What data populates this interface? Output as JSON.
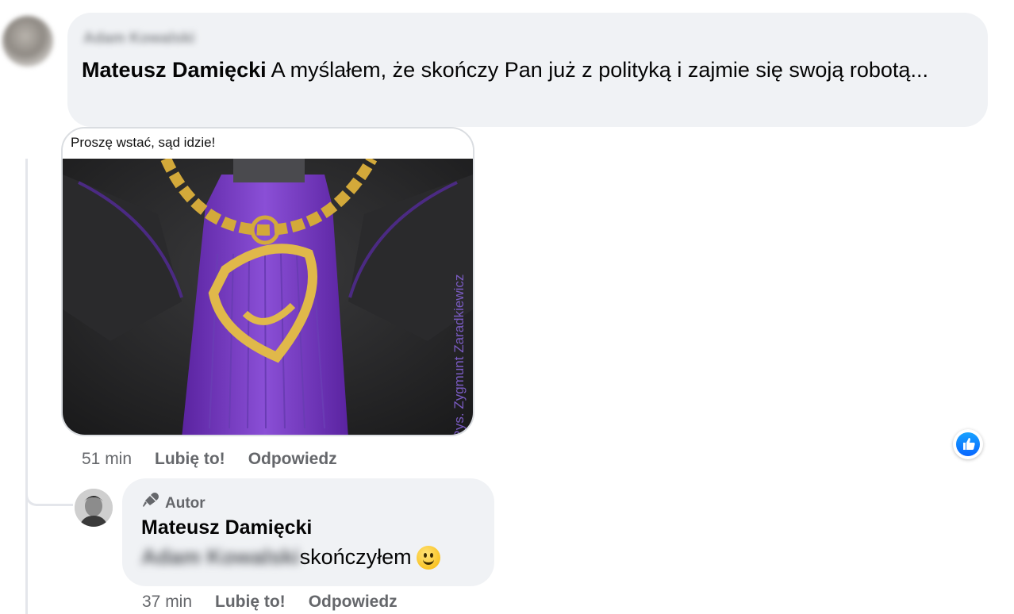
{
  "comment": {
    "author_blurred": "Adam Kowalski",
    "mention": "Mateusz Damięcki",
    "text": " A myślałem, że skończy Pan już z polityką i zajmie się swoją robotą...",
    "image_caption": "Proszę wstać, sąd idzie!",
    "image_credit": "Rys. Zygmunt Zaradkiewicz",
    "actions": {
      "time": "51 min",
      "like": "Lubię to!",
      "reply": "Odpowiedz"
    }
  },
  "reply": {
    "badge": "Autor",
    "author": "Mateusz Damięcki",
    "mention_blurred": "Adam Kowalski",
    "text": "skończyłem",
    "emoji": "slightly-smiling-face",
    "actions": {
      "time": "37 min",
      "like": "Lubię to!",
      "reply": "Odpowiedz"
    }
  },
  "icons": {
    "like": "thumbs-up-icon",
    "author": "microphone-icon"
  },
  "colors": {
    "bubble": "#f0f2f5",
    "like_blue": "#0866ff",
    "muted": "#65676b",
    "robe_purple": "#6a2fb2",
    "chain_gold": "#d3a93a"
  }
}
